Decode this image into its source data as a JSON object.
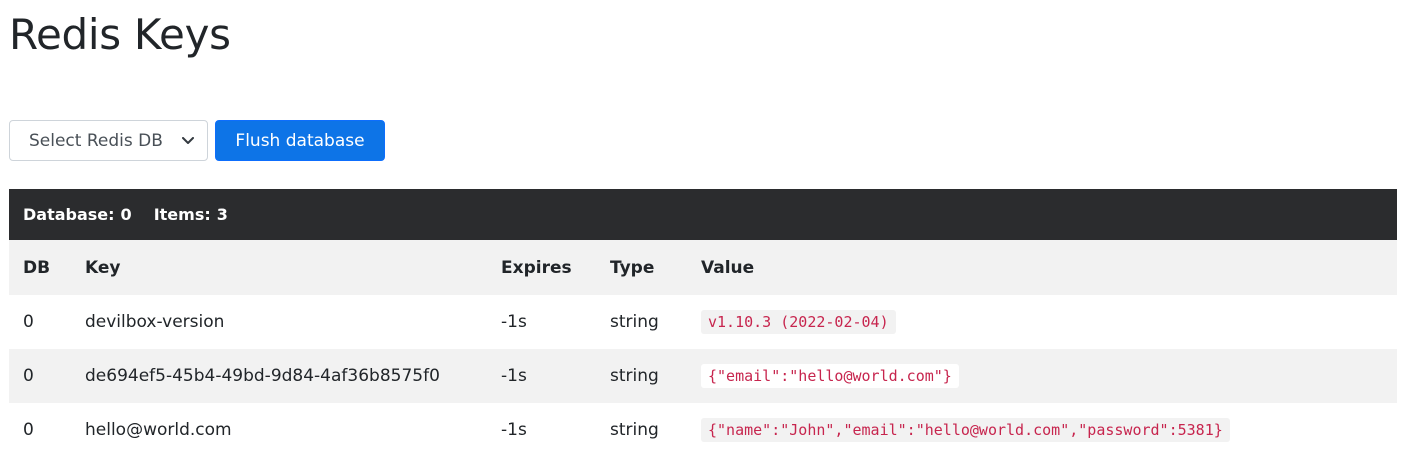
{
  "page": {
    "title": "Redis Keys"
  },
  "toolbar": {
    "select_label": "Select Redis DB",
    "flush_label": "Flush database"
  },
  "panel": {
    "db_label": "Database:",
    "db_value": "0",
    "items_label": "Items:",
    "items_value": "3"
  },
  "table": {
    "headers": {
      "db": "DB",
      "key": "Key",
      "expires": "Expires",
      "type": "Type",
      "value": "Value"
    },
    "rows": [
      {
        "db": "0",
        "key": "devilbox-version",
        "expires": "-1s",
        "type": "string",
        "value": "v1.10.3 (2022-02-04)"
      },
      {
        "db": "0",
        "key": "de694ef5-45b4-49bd-9d84-4af36b8575f0",
        "expires": "-1s",
        "type": "string",
        "value": "{\"email\":\"hello@world.com\"}"
      },
      {
        "db": "0",
        "key": "hello@world.com",
        "expires": "-1s",
        "type": "string",
        "value": "{\"name\":\"John\",\"email\":\"hello@world.com\",\"password\":5381}"
      }
    ]
  },
  "colors": {
    "primary_button": "#0d74e7",
    "header_bar": "#2b2c2e",
    "code_text": "#c7254e",
    "stripe": "#f2f2f2"
  },
  "icons": {
    "select_chevron": "chevron-down-icon"
  }
}
